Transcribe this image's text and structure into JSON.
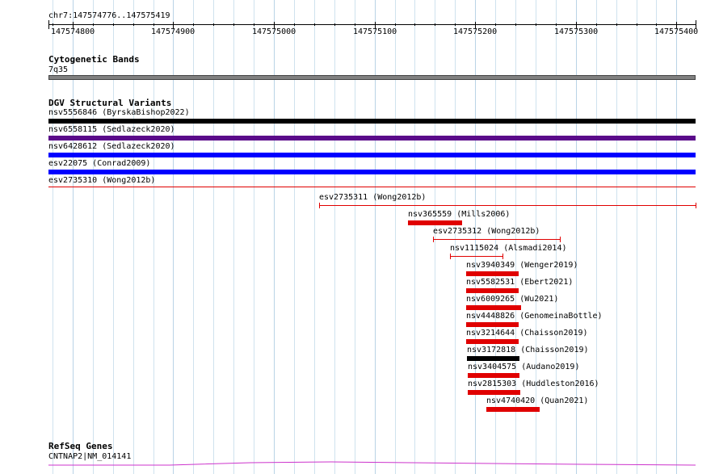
{
  "ruler": {
    "region": "chr7:147574776..147575419",
    "start": 147574776,
    "end": 147575419,
    "labels": [
      "147574800",
      "147574900",
      "147575000",
      "147575100",
      "147575200",
      "147575300",
      "147575400"
    ]
  },
  "cytoband": {
    "title": "Cytogenetic Bands",
    "band": "7q35",
    "color": "#808080"
  },
  "dgv": {
    "title": "DGV Structural Variants",
    "full": [
      {
        "label": "nsv5556846 (ByrskaBishop2022)",
        "color": "#000000"
      },
      {
        "label": "nsv6558115 (Sedlazeck2020)",
        "color": "#5a0a8a"
      },
      {
        "label": "nsv6428612 (Sedlazeck2020)",
        "color": "#0000ff"
      },
      {
        "label": "esv22075 (Conrad2009)",
        "color": "#0000ff"
      },
      {
        "label": "esv2735310 (Wong2012b)",
        "color": "#e00000"
      }
    ],
    "partial": [
      {
        "label": "esv2735311 (Wong2012b)",
        "start": 147575045,
        "end": 147575419,
        "style": "line",
        "color": "#e00000"
      },
      {
        "label": "nsv365559 (Mills2006)",
        "start": 147575133,
        "end": 147575187,
        "style": "bar",
        "color": "#e00000"
      },
      {
        "label": "esv2735312 (Wong2012b)",
        "start": 147575158,
        "end": 147575284,
        "style": "line",
        "color": "#e00000"
      },
      {
        "label": "nsv1115024 (Alsmadi2014)",
        "start": 147575175,
        "end": 147575227,
        "style": "line",
        "color": "#e00000"
      },
      {
        "label": "nsv3940349 (Wenger2019)",
        "start": 147575191,
        "end": 147575243,
        "style": "bar",
        "color": "#e00000"
      },
      {
        "label": "nsv5582531 (Ebert2021)",
        "start": 147575191,
        "end": 147575243,
        "style": "bar",
        "color": "#e00000"
      },
      {
        "label": "nsv6009265 (Wu2021)",
        "start": 147575191,
        "end": 147575246,
        "style": "bar",
        "color": "#e00000"
      },
      {
        "label": "nsv4448826 (GenomeinaBottle)",
        "start": 147575191,
        "end": 147575243,
        "style": "bar",
        "color": "#e00000"
      },
      {
        "label": "nsv3214644 (Chaisson2019)",
        "start": 147575191,
        "end": 147575243,
        "style": "bar",
        "color": "#e00000"
      },
      {
        "label": "nsv3172818 (Chaisson2019)",
        "start": 147575192,
        "end": 147575244,
        "style": "bar",
        "color": "#000000"
      },
      {
        "label": "nsv3404575 (Audano2019)",
        "start": 147575193,
        "end": 147575244,
        "style": "bar",
        "color": "#e00000"
      },
      {
        "label": "nsv2815303 (Huddleston2016)",
        "start": 147575193,
        "end": 147575245,
        "style": "bar",
        "color": "#e00000"
      },
      {
        "label": "nsv4740420 (Quan2021)",
        "start": 147575211,
        "end": 147575264,
        "style": "bar",
        "color": "#e00000"
      }
    ]
  },
  "refseq": {
    "title": "RefSeq Genes",
    "gene": "CNTNAP2|NM_014141",
    "color": "#cc33cc"
  }
}
